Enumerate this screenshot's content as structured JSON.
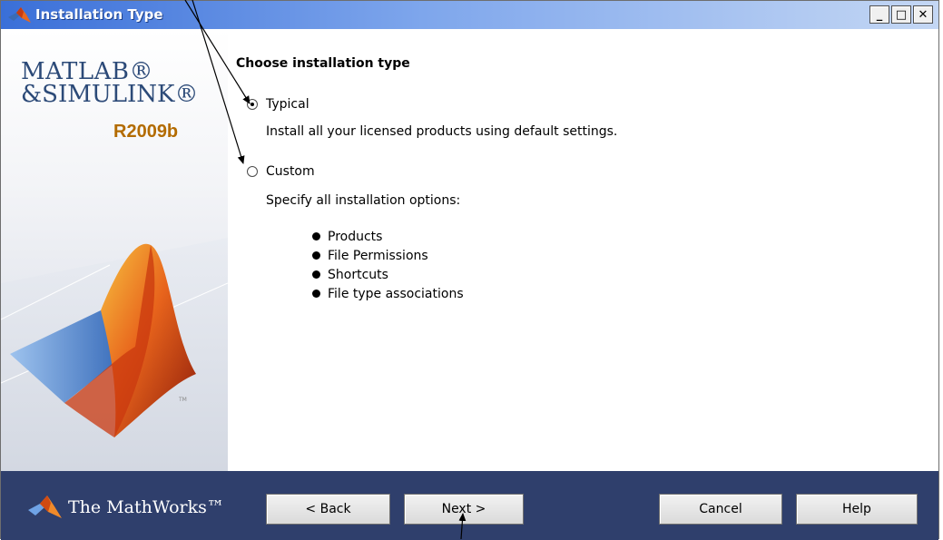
{
  "window": {
    "title": "Installation Type",
    "minimize": "_",
    "maximize": "□",
    "close": "✕"
  },
  "banner": {
    "product_line1": "MATLAB®",
    "product_line2": "&SIMULINK®",
    "release": "R2009b",
    "trademark": "TM"
  },
  "content": {
    "heading": "Choose installation type",
    "typical": {
      "label": "Typical",
      "selected": true,
      "description": "Install all your licensed products using default settings."
    },
    "custom": {
      "label": "Custom",
      "selected": false,
      "description": "Specify all installation options:"
    },
    "custom_options": [
      "Products",
      "File Permissions",
      "Shortcuts",
      "File type associations"
    ]
  },
  "footer": {
    "brand": "The MathWorks™",
    "back_label": "< Back",
    "next_label": "Next >",
    "cancel_label": "Cancel",
    "help_label": "Help"
  },
  "colors": {
    "footer_bg": "#2f3f6c",
    "title_bar": "#3a6fd8",
    "release_accent": "#b36b00"
  }
}
